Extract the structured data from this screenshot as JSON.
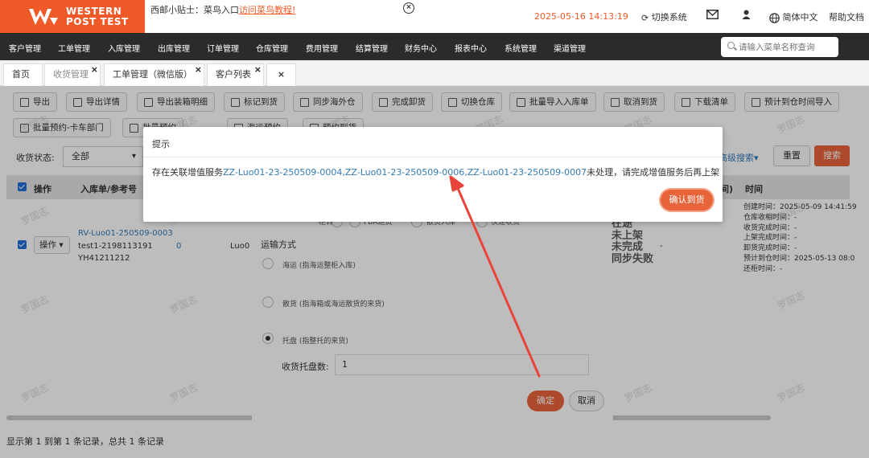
{
  "header": {
    "logo": {
      "line1": "WESTERN",
      "line2a": "POST",
      "line2b": "TEST"
    },
    "tip_prefix": "西邮小贴士：菜鸟入口",
    "tip_link": "访问菜鸟教程!",
    "datetime": "2025-05-16 14:13:19",
    "switch_system": "切换系统",
    "language": "简体中文",
    "help": "帮助文档"
  },
  "nav": {
    "items": [
      "客户管理",
      "工单管理",
      "入库管理",
      "出库管理",
      "订单管理",
      "仓库管理",
      "费用管理",
      "结算管理",
      "财务中心",
      "报表中心",
      "系统管理",
      "渠道管理"
    ],
    "search_placeholder": "请输入菜单名称查询"
  },
  "tabs": [
    "首页",
    "收货管理",
    "工单管理（微信版）",
    "客户列表"
  ],
  "toolbar": {
    "row1": [
      "导出",
      "导出详情",
      "导出装箱明细",
      "标记到货",
      "同步海外仓",
      "完成卸货",
      "切换仓库",
      "批量导入入库单",
      "取消到货",
      "下载清单",
      "预计到仓时间导入"
    ],
    "row2": [
      "批量预约-卡车部门",
      "批量预约",
      "海运预约",
      "预约到货"
    ]
  },
  "filter": {
    "label": "收货状态:",
    "value": "全部",
    "advanced": "高级搜索",
    "reset": "重置",
    "search": "搜索"
  },
  "table": {
    "headers": {
      "op": "操作",
      "ref": "入库单/参考号",
      "time_suffix": "间)",
      "time": "时间"
    },
    "row": {
      "ref1": "RV-Luo01-250509-0003",
      "ref2": "test1-2198113191",
      "ref3": "YH41211212",
      "count": "0",
      "code": "Luo0",
      "op": "操作",
      "dash": "-",
      "times": [
        "创建时间：2025-05-09 14:41:59",
        "仓库收相时间：-",
        "收货完成时间：-",
        "上架完成时间：-",
        "卸货完成时间：-",
        "预计到仓时间：2025-05-13 08:0",
        "还柜时间：-"
      ]
    }
  },
  "footer": "显示第 1 到第 1 条记录，总共 1 条记录",
  "watermark": "罗国志",
  "modal2": {
    "top_options": [
      "柜转",
      "FBA退货",
      "散货入库",
      "快速收货"
    ],
    "transport_label": "运输方式",
    "options": [
      {
        "text": "海运 (指海运整柜入库)",
        "selected": false
      },
      {
        "text": "散货 (指海箱或海运散货的来货)",
        "selected": false
      },
      {
        "text": "托盘 (指整托的来货)",
        "selected": true
      }
    ],
    "pallet_label": "收货托盘数:",
    "pallet_value": "1",
    "ok": "确定",
    "cancel": "取消",
    "side_status": [
      "在途",
      "未上架",
      "未完成",
      "同步失败"
    ]
  },
  "dialog": {
    "title": "提示",
    "msg_prefix": "存在关联增值服务",
    "links": "ZZ-Luo01-23-250509-0004,ZZ-Luo01-23-250509-0006,ZZ-Luo01-23-250509-0007",
    "msg_suffix": "未处理，请完成增值服务后再上架",
    "confirm": "确认到货"
  },
  "colors": {
    "brand": "#f05a28",
    "nav_bg": "#2b2b2b",
    "link": "#337ab7",
    "button": "#e8643a",
    "arrow": "#e8443a"
  }
}
